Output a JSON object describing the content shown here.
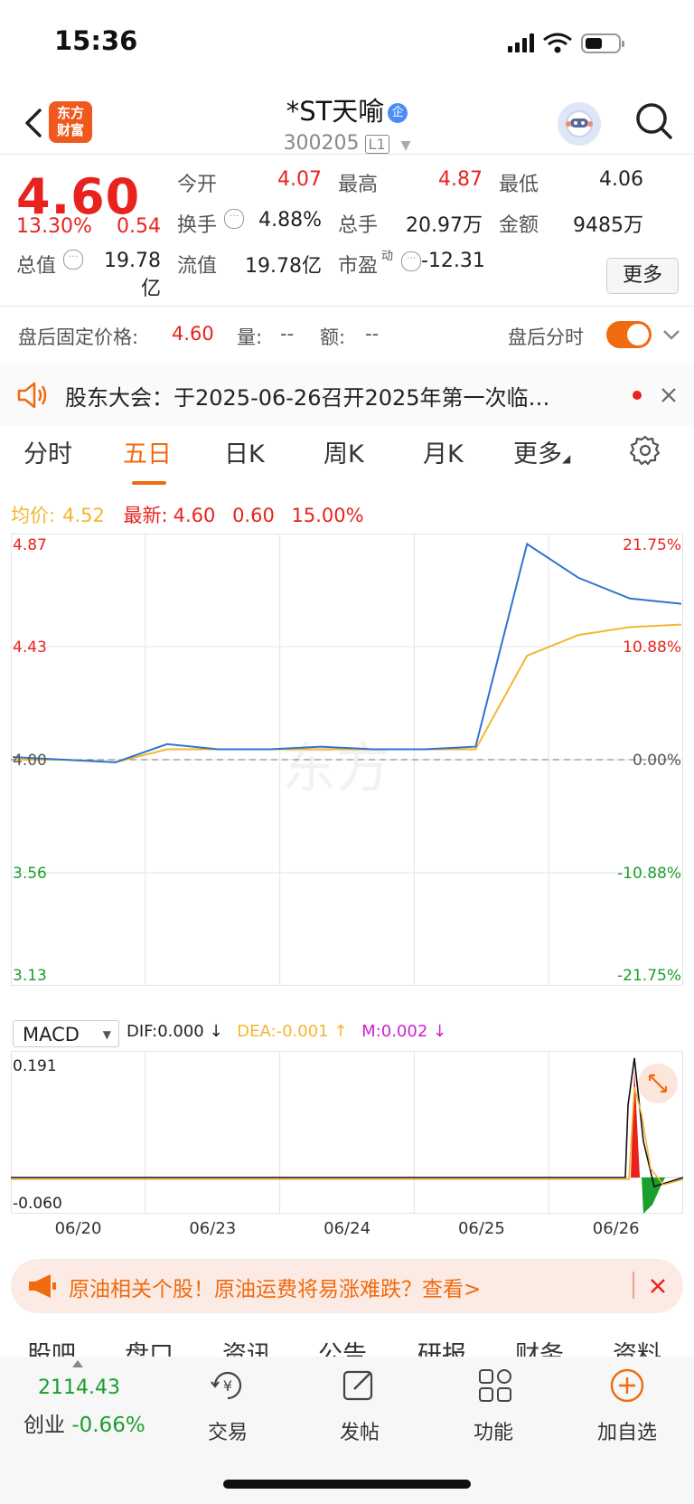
{
  "status_bar": {
    "time": "15:36"
  },
  "header": {
    "logo_text_1": "东方",
    "logo_text_2": "财富",
    "title": "*ST天喻",
    "qi_badge": "企",
    "code": "300205",
    "level": "L1"
  },
  "quote": {
    "price": "4.60",
    "pct": "13.30%",
    "chg": "0.54",
    "open_label": "今开",
    "open": "4.07",
    "high_label": "最高",
    "high": "4.87",
    "low_label": "最低",
    "low": "4.06",
    "turnover_label": "换手",
    "turnover": "4.88%",
    "volume_label": "总手",
    "volume": "20.97万",
    "amount_label": "金额",
    "amount": "9485万",
    "mktcap_label": "总值",
    "mktcap": "19.78亿",
    "float_label": "流值",
    "float": "19.78亿",
    "pe_label": "市盈",
    "pe_sup": "动",
    "pe": "-12.31",
    "more": "更多"
  },
  "after_hours": {
    "label": "盘后固定价格:",
    "price": "4.60",
    "vol_label": "量:",
    "vol": "--",
    "amt_label": "额:",
    "amt": "--",
    "toggle_label": "盘后分时"
  },
  "notice": {
    "text": "股东大会：于2025-06-26召开2025年第一次临…"
  },
  "tabs": [
    "分时",
    "五日",
    "日K",
    "周K",
    "月K",
    "更多"
  ],
  "active_tab": 1,
  "chart_header": {
    "avg_label": "均价:",
    "avg": "4.52",
    "latest_label": "最新:",
    "latest": "4.60",
    "chg": "0.60",
    "pct": "15.00%"
  },
  "chart_data": {
    "type": "line",
    "x": [
      "06/20",
      "06/23",
      "06/24",
      "06/25",
      "06/26"
    ],
    "price_axis": {
      "left_ticks": [
        "4.87",
        "4.43",
        "4.00",
        "3.56",
        "3.13"
      ],
      "right_ticks": [
        "21.75%",
        "10.88%",
        "0.00%",
        "-10.88%",
        "-21.75%"
      ],
      "ylim": [
        3.13,
        4.87
      ]
    },
    "series": [
      {
        "name": "最新",
        "color": "#2f74d0",
        "values": [
          4.01,
          4.0,
          3.99,
          4.06,
          4.04,
          4.04,
          4.05,
          4.04,
          4.04,
          4.05,
          4.83,
          4.7,
          4.62,
          4.6
        ]
      },
      {
        "name": "均价",
        "color": "#f5b630",
        "values": [
          4.0,
          4.0,
          3.99,
          4.04,
          4.04,
          4.04,
          4.04,
          4.04,
          4.04,
          4.04,
          4.4,
          4.48,
          4.51,
          4.52
        ]
      }
    ],
    "macd": {
      "indicator": "MACD",
      "dif": "DIF:0.000",
      "dea": "DEA:-0.001",
      "m": "M:0.002",
      "ylim_top": "0.191",
      "ylim_bottom": "-0.060"
    }
  },
  "banner": {
    "text": "原油相关个股！原油运费将易涨难跌？查看>"
  },
  "sub_tabs": [
    "股吧",
    "盘口",
    "资讯",
    "公告",
    "研报",
    "财务",
    "资料"
  ],
  "bottom_nav": {
    "index_value": "2114.43",
    "index_name": "创业",
    "index_pct": "-0.66%",
    "trade": "交易",
    "post": "发帖",
    "func": "功能",
    "add": "加自选"
  },
  "colors": {
    "up": "#e8231f",
    "down": "#1a9e2c",
    "accent": "#f06a0f"
  }
}
